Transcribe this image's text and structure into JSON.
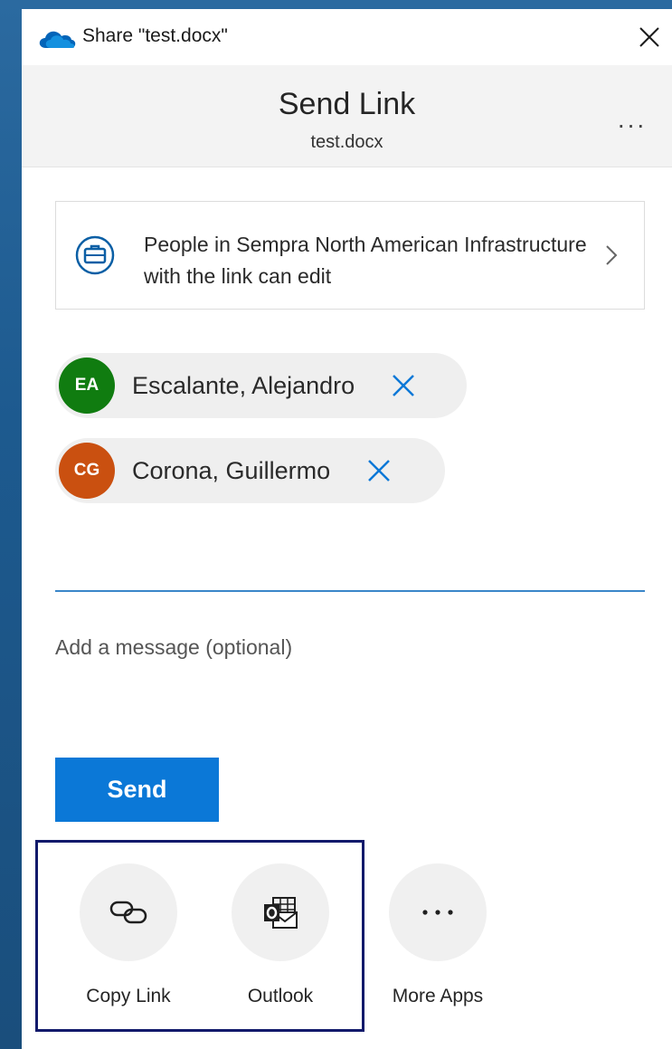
{
  "window": {
    "title": "Share \"test.docx\"",
    "cloud_icon": "onedrive-cloud-icon",
    "accent": "#0b78d7"
  },
  "header": {
    "title": "Send Link",
    "subtitle": "test.docx",
    "more_label": "..."
  },
  "permission": {
    "text": "People in Sempra North American Infrastructure with the link can edit",
    "icon": "briefcase-icon"
  },
  "recipients": [
    {
      "initials": "EA",
      "name": "Escalante, Alejandro",
      "color": "#107c10"
    },
    {
      "initials": "CG",
      "name": "Corona, Guillermo",
      "color": "#ca5010"
    }
  ],
  "to_field": {
    "value": "",
    "placeholder": ""
  },
  "message": {
    "placeholder": "Add a message (optional)"
  },
  "send_label": "Send",
  "apps": [
    {
      "label": "Copy Link",
      "icon": "link-icon"
    },
    {
      "label": "Outlook",
      "icon": "outlook-icon"
    },
    {
      "label": "More Apps",
      "icon": "ellipsis-icon"
    }
  ]
}
